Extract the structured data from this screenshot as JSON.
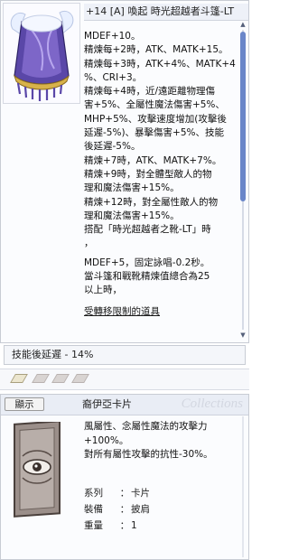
{
  "item": {
    "title": "+14 [A] 喚起 時光超越者斗篷-LT",
    "description": [
      "MDEF+10。",
      "精煉每+2時，ATK、MATK+15。",
      "精煉每+3時，ATK+4%、MATK+4",
      "%、CRI+3。",
      "精煉每+4時，近/遠距離物理傷",
      "害+5%、全屬性魔法傷害+5%、",
      "MHP+5%、攻擊速度增加(攻擊後",
      "延遲-5%)、暴擊傷害+5%、技能",
      "後延遲-5%。",
      "精煉+7時，ATK、MATK+7%。",
      "精煉+9時，對全體型敵人的物",
      "理和魔法傷害+15%。",
      "精煉+12時，對全屬性敵人的物",
      "理和魔法傷害+15%。",
      "搭配「時光超越者之靴-LT」時",
      "，",
      "MDEF+5，固定詠唱-0.2秒。",
      "當斗篷和戰靴精煉值總合為25",
      "以上時，"
    ],
    "restriction_link": "受轉移限制的道具"
  },
  "enchant_bar": {
    "text": "技能後延遲 - 14%"
  },
  "card": {
    "show_button": "顯示",
    "name": "裔伊亞卡片",
    "watermark": "Collections",
    "description": [
      "風屬性、念屬性魔法的攻擊力",
      "+100%。",
      "對所有屬性攻擊的抗性-30%。"
    ],
    "properties": [
      {
        "key": "系列",
        "sep": "：",
        "value": "卡片"
      },
      {
        "key": "裝備",
        "sep": "：",
        "value": "披肩"
      },
      {
        "key": "重量",
        "sep": "：",
        "value": "1"
      }
    ]
  },
  "colors": {
    "scroll_thumb": "#6a86c9",
    "window_border": "#c8ccd4",
    "header_bg": "#e9edf5"
  },
  "icons": {
    "item": "winged-cloak-icon",
    "card": "eye-card-icon",
    "slot": "card-slot-icon"
  }
}
